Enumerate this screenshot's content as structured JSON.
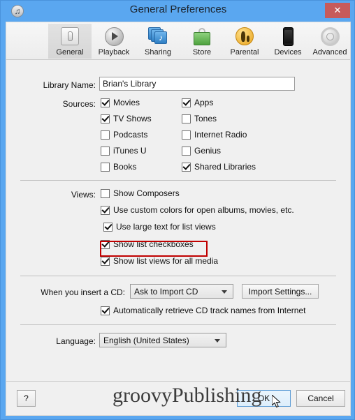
{
  "window": {
    "title": "General Preferences",
    "app_icon": "itunes-note-icon",
    "close_label": "✕",
    "close_color": "#c75b5b",
    "titlebar_color": "#5aa7f0"
  },
  "toolbar": {
    "items": [
      {
        "label": "General",
        "icon": "general-switch-icon",
        "selected": true
      },
      {
        "label": "Playback",
        "icon": "play-circle-icon",
        "selected": false
      },
      {
        "label": "Sharing",
        "icon": "sharing-stack-icon",
        "selected": false
      },
      {
        "label": "Store",
        "icon": "shopping-bag-icon",
        "selected": false
      },
      {
        "label": "Parental",
        "icon": "parental-figures-icon",
        "selected": false
      },
      {
        "label": "Devices",
        "icon": "iphone-icon",
        "selected": false
      },
      {
        "label": "Advanced",
        "icon": "gear-icon",
        "selected": false
      }
    ]
  },
  "library": {
    "label": "Library Name:",
    "value": "Brian's Library",
    "placeholder": ""
  },
  "sources": {
    "label": "Sources:",
    "column_left": [
      {
        "label": "Movies",
        "checked": true
      },
      {
        "label": "TV Shows",
        "checked": true
      },
      {
        "label": "Podcasts",
        "checked": false
      },
      {
        "label": "iTunes U",
        "checked": false
      },
      {
        "label": "Books",
        "checked": false
      }
    ],
    "column_right": [
      {
        "label": "Apps",
        "checked": true
      },
      {
        "label": "Tones",
        "checked": false
      },
      {
        "label": "Internet Radio",
        "checked": false
      },
      {
        "label": "Genius",
        "checked": false
      },
      {
        "label": "Shared Libraries",
        "checked": true
      }
    ]
  },
  "views": {
    "label": "Views:",
    "items": [
      {
        "label": "Show Composers",
        "checked": false,
        "highlighted": false
      },
      {
        "label": "Use custom colors for open albums, movies, etc.",
        "checked": true,
        "highlighted": false
      },
      {
        "label": "Use large text for list views",
        "checked": true,
        "highlighted": true
      },
      {
        "label": "Show list checkboxes",
        "checked": true,
        "highlighted": false
      },
      {
        "label": "Show list views for all media",
        "checked": true,
        "highlighted": false
      }
    ],
    "highlight_color": "#c00000"
  },
  "cd": {
    "label": "When you insert a CD:",
    "selected_option": "Ask to Import CD",
    "import_settings_label": "Import Settings...",
    "auto_retrieve": {
      "label": "Automatically retrieve CD track names from Internet",
      "checked": true
    }
  },
  "language": {
    "label": "Language:",
    "selected_option": "English (United States)"
  },
  "footer": {
    "help_label": "?",
    "ok_label": "OK",
    "cancel_label": "Cancel",
    "watermark": "groovyPublishing"
  }
}
